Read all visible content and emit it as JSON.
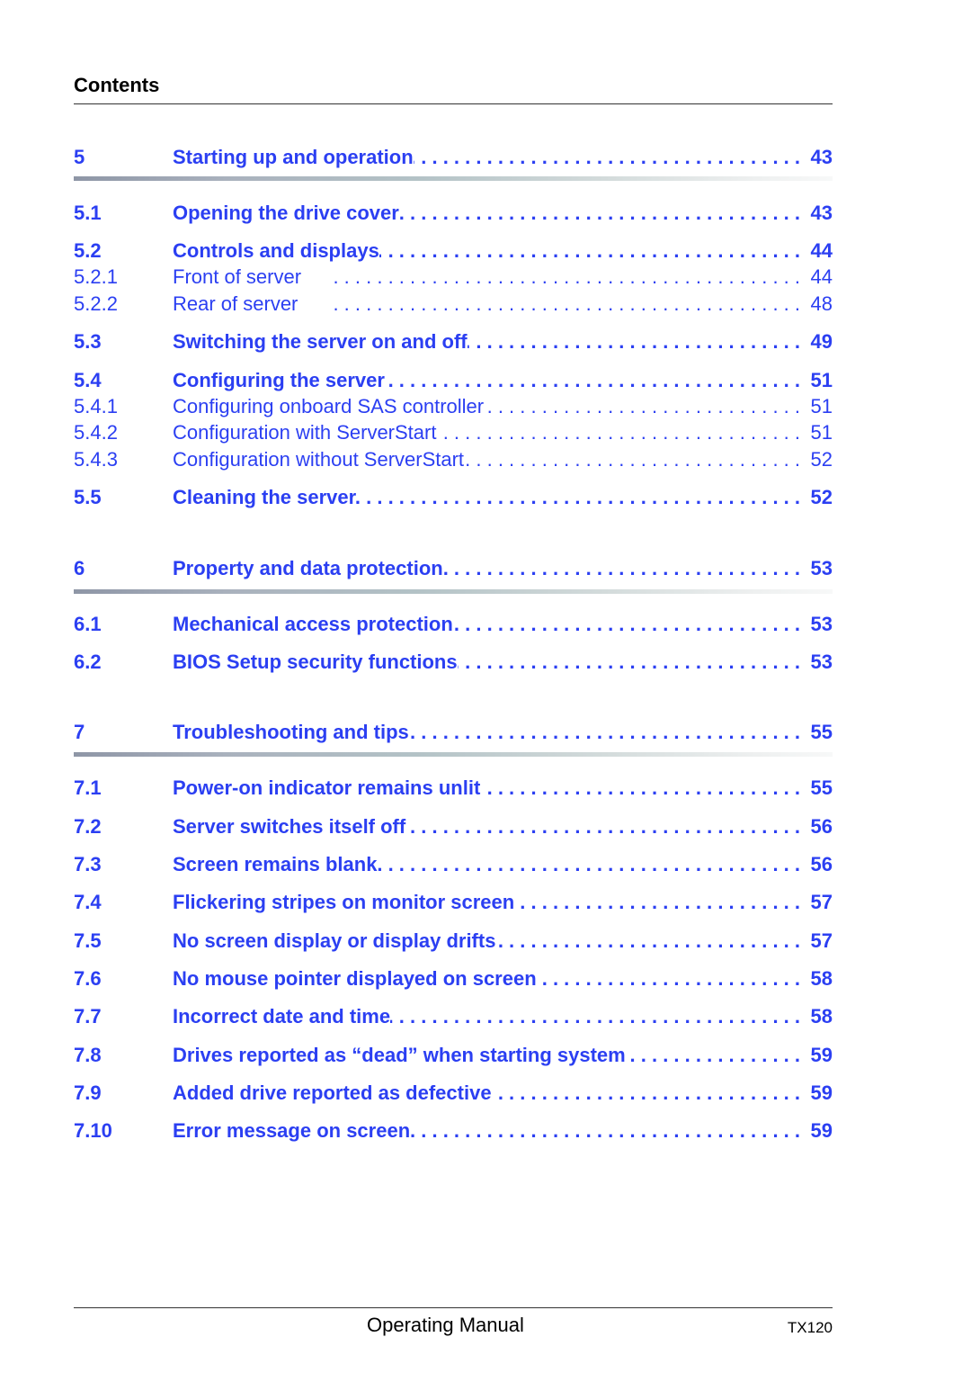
{
  "header": {
    "title": "Contents"
  },
  "colors": {
    "link": "#2b3ff2",
    "text": "#000000"
  },
  "toc": [
    {
      "num": "5",
      "title": "Starting up and operation",
      "page": "43",
      "level": 1
    },
    {
      "num": "5.1",
      "title": "Opening the drive cover",
      "page": "43",
      "level": 2
    },
    {
      "num": "5.2",
      "title": "Controls and displays",
      "page": "44",
      "level": 2
    },
    {
      "num": "5.2.1",
      "title": "Front of server",
      "page": "44",
      "level": 3
    },
    {
      "num": "5.2.2",
      "title": "Rear of server",
      "page": "48",
      "level": 3
    },
    {
      "num": "5.3",
      "title": "Switching the server on and off",
      "page": "49",
      "level": 2
    },
    {
      "num": "5.4",
      "title": "Configuring the server",
      "page": "51",
      "level": 2
    },
    {
      "num": "5.4.1",
      "title": "Configuring onboard SAS controller",
      "page": "51",
      "level": 3
    },
    {
      "num": "5.4.2",
      "title": "Configuration with ServerStart",
      "page": "51",
      "level": 3
    },
    {
      "num": "5.4.3",
      "title": "Configuration without ServerStart",
      "page": "52",
      "level": 3
    },
    {
      "num": "5.5",
      "title": "Cleaning the server",
      "page": "52",
      "level": 2
    },
    {
      "num": "6",
      "title": "Property and data protection",
      "page": "53",
      "level": 1
    },
    {
      "num": "6.1",
      "title": "Mechanical access protection",
      "page": "53",
      "level": 2
    },
    {
      "num": "6.2",
      "title": "BIOS Setup security functions",
      "page": "53",
      "level": 2
    },
    {
      "num": "7",
      "title": "Troubleshooting and tips",
      "page": "55",
      "level": 1
    },
    {
      "num": "7.1",
      "title": "Power-on indicator remains unlit",
      "page": "55",
      "level": 2
    },
    {
      "num": "7.2",
      "title": "Server switches itself off",
      "page": "56",
      "level": 2
    },
    {
      "num": "7.3",
      "title": "Screen remains blank",
      "page": "56",
      "level": 2
    },
    {
      "num": "7.4",
      "title": "Flickering stripes on monitor screen",
      "page": "57",
      "level": 2
    },
    {
      "num": "7.5",
      "title": "No screen display or display drifts",
      "page": "57",
      "level": 2
    },
    {
      "num": "7.6",
      "title": "No mouse pointer displayed on screen",
      "page": "58",
      "level": 2
    },
    {
      "num": "7.7",
      "title": "Incorrect date and time",
      "page": "58",
      "level": 2
    },
    {
      "num": "7.8",
      "title": "Drives reported as “dead” when starting system",
      "page": "59",
      "level": 2
    },
    {
      "num": "7.9",
      "title": "Added drive reported as defective",
      "page": "59",
      "level": 2
    },
    {
      "num": "7.10",
      "title": "Error message on screen",
      "page": "59",
      "level": 2
    }
  ],
  "leader_dots": ". . . . . . . . . . . . . . . . . . . . . . . . . . . . . . . . . . . . . . . . . . .",
  "footer": {
    "title": "Operating Manual",
    "model": "TX120"
  }
}
